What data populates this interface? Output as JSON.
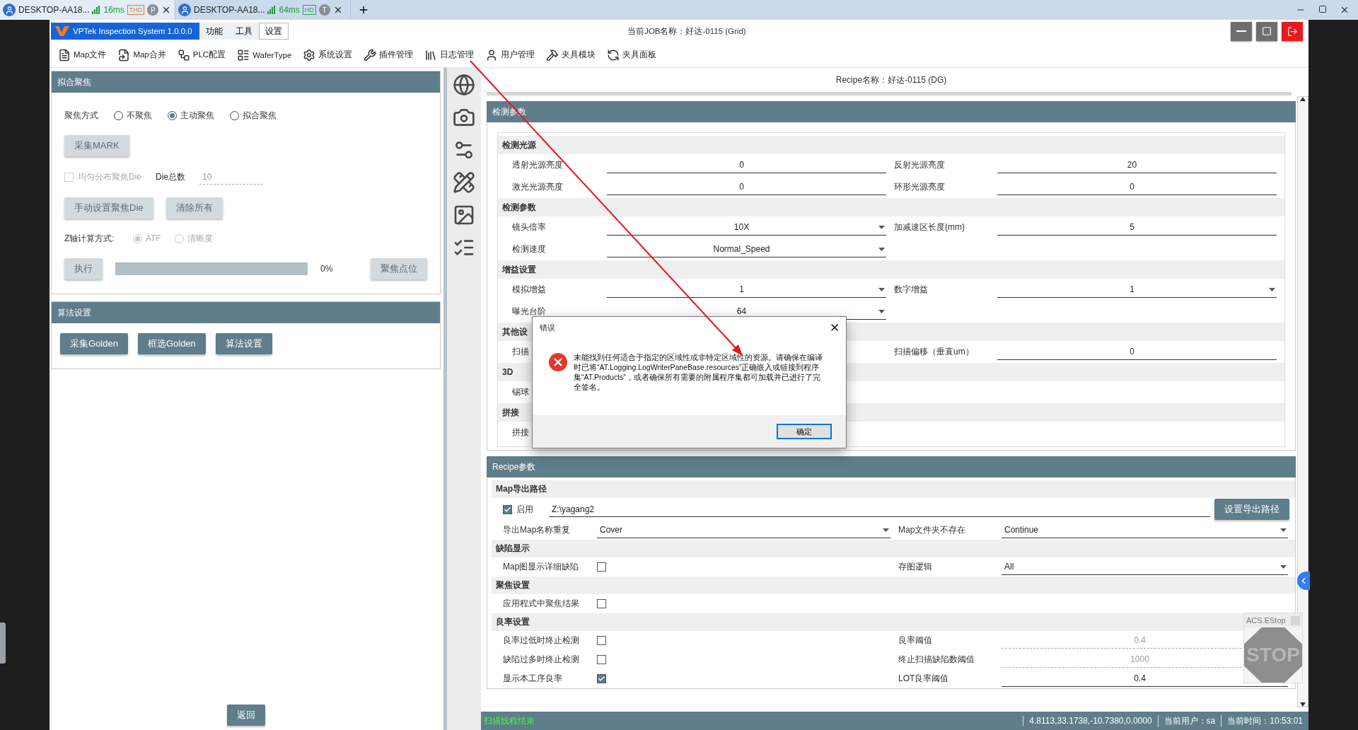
{
  "browser": {
    "tabs": [
      {
        "title": "DESKTOP-AA18...",
        "ping": "16ms",
        "quality": "THD",
        "color": "#d9822b",
        "account": "P",
        "selected": true
      },
      {
        "title": "DESKTOP-AA18...",
        "ping": "64ms",
        "quality": "HD",
        "color": "#2e9e4f",
        "account": "T",
        "selected": false
      }
    ]
  },
  "app": {
    "title": "VPTek Inspection System 1.0.0.0",
    "menu": [
      {
        "label": "功能",
        "selected": false
      },
      {
        "label": "工具",
        "selected": false
      },
      {
        "label": "设置",
        "selected": true
      }
    ],
    "job_title": "当前JOB名称：好达-0115 (Grid)"
  },
  "toolbar": [
    "Map文件",
    "Map合并",
    "PLC配置",
    "WaferType",
    "系统设置",
    "插件管理",
    "日志管理",
    "用户管理",
    "夹具模块",
    "夹具面板"
  ],
  "focus_panel": {
    "title": "拟合聚焦",
    "mode_label": "聚焦方式",
    "modes": [
      {
        "label": "不聚焦",
        "selected": false
      },
      {
        "label": "主动聚焦",
        "selected": true
      },
      {
        "label": "拟合聚焦",
        "selected": false
      }
    ],
    "mark_button": {
      "label": "采集MARK",
      "disabled": true
    },
    "even_checkbox": {
      "label": "均匀分布聚焦Die",
      "checked": false,
      "disabled": true
    },
    "die_count": {
      "label": "Die总数",
      "value": "10",
      "disabled": true
    },
    "buttons": [
      {
        "label": "手动设置聚焦Die",
        "disabled": true
      },
      {
        "label": "清除所有",
        "disabled": true
      }
    ],
    "z_label": "Z轴计算方式:",
    "z_modes": [
      {
        "label": "ATF",
        "selected": true,
        "disabled": true
      },
      {
        "label": "清晰度",
        "selected": false,
        "disabled": true
      }
    ],
    "run_button": {
      "label": "执行",
      "disabled": true
    },
    "progress": {
      "level": 0,
      "reading": "0%"
    },
    "point_button": {
      "label": "聚焦点位",
      "disabled": true
    }
  },
  "algo_panel": {
    "title": "算法设置",
    "buttons": [
      {
        "label": "采集Golden"
      },
      {
        "label": "框选Golden"
      },
      {
        "label": "算法设置"
      }
    ]
  },
  "back_button": "返回",
  "recipe_name": "Recipe名称：好达-0115 (DG)",
  "params": {
    "title": "检测参数",
    "sections": [
      {
        "title": "检测光源",
        "rows": [
          {
            "kind": "fields",
            "cells": [
              {
                "label": "透射光源亮度",
                "kind": "text",
                "value": "0"
              },
              {
                "label": "反射光源亮度",
                "kind": "text",
                "value": "20"
              }
            ]
          },
          {
            "kind": "fields",
            "cells": [
              {
                "label": "激光光源亮度",
                "kind": "text",
                "value": "0"
              },
              {
                "label": "环形光源亮度",
                "kind": "text",
                "value": "0"
              }
            ]
          }
        ]
      },
      {
        "title": "检测参数",
        "rows": [
          {
            "kind": "fields",
            "cells": [
              {
                "label": "镜头倍率",
                "kind": "dropdown",
                "value": "10X"
              },
              {
                "label": "加减速区长度(mm)",
                "kind": "text",
                "value": "5"
              }
            ]
          },
          {
            "kind": "fields",
            "cells": [
              {
                "label": "检测速度",
                "kind": "dropdown",
                "value": "Normal_Speed"
              }
            ]
          }
        ]
      },
      {
        "title": "增益设置",
        "rows": [
          {
            "kind": "fields",
            "cells": [
              {
                "label": "模拟增益",
                "kind": "dropdown",
                "value": "1"
              },
              {
                "label": "数字增益",
                "kind": "dropdown",
                "value": "1"
              }
            ]
          },
          {
            "kind": "fields",
            "cells": [
              {
                "label": "曝光台阶",
                "kind": "dropdown",
                "value": "64"
              }
            ]
          }
        ]
      },
      {
        "title": "其他设",
        "rows": [
          {
            "kind": "fields",
            "cells": [
              {
                "label": "扫描"
              },
              {
                "label": "扫描偏移（垂直um）",
                "kind": "text",
                "value": "0"
              }
            ]
          }
        ]
      },
      {
        "title": "3D",
        "rows": [
          {
            "kind": "fields",
            "cells": [
              {
                "label": "锡球"
              }
            ]
          }
        ]
      },
      {
        "title": "拼接",
        "rows": [
          {
            "kind": "fields",
            "cells": [
              {
                "label": "拼接"
              }
            ]
          }
        ]
      }
    ]
  },
  "recipe": {
    "title": "Recipe参数",
    "sections": [
      {
        "title": "Map导出路径",
        "rows": [
          {
            "kind": "path",
            "enable": {
              "label": "启用",
              "checked": true
            },
            "value": "Z:\\yagang2",
            "button": "设置导出路径"
          },
          {
            "kind": "fields",
            "cells": [
              {
                "label": "导出Map名称重复",
                "kind": "dropdown",
                "value": "Cover"
              },
              {
                "label": "Map文件夹不存在",
                "kind": "dropdown",
                "value": "Continue"
              }
            ]
          }
        ]
      },
      {
        "title": "缺陷显示",
        "rows": [
          {
            "kind": "fields",
            "cells": [
              {
                "label": "Map图显示详细缺陷",
                "kind": "checkbox",
                "checked": false
              },
              {
                "label": "存图逻辑",
                "kind": "dropdown",
                "value": "All"
              }
            ]
          }
        ]
      },
      {
        "title": "聚焦设置",
        "rows": [
          {
            "kind": "fields",
            "cells": [
              {
                "label": "应用程式中聚焦结果",
                "kind": "checkbox",
                "checked": false
              }
            ]
          }
        ]
      },
      {
        "title": "良率设置",
        "rows": [
          {
            "kind": "fields",
            "cells": [
              {
                "label": "良率过低时终止检测",
                "kind": "checkbox",
                "checked": false
              },
              {
                "label": "良率阈值",
                "kind": "text",
                "value": "0.4",
                "disabled": true
              }
            ]
          },
          {
            "kind": "fields",
            "cells": [
              {
                "label": "缺陷过多时终止检测",
                "kind": "checkbox",
                "checked": false
              },
              {
                "label": "终止扫描缺陷数阈值",
                "kind": "text",
                "value": "1000",
                "disabled": true
              }
            ]
          },
          {
            "kind": "fields",
            "cells": [
              {
                "label": "显示本工序良率",
                "kind": "checkbox",
                "checked": true
              },
              {
                "label": "LOT良率阈值",
                "kind": "text",
                "value": "0.4"
              }
            ]
          }
        ]
      }
    ]
  },
  "status": {
    "message": "扫描线程结束",
    "position": "4.8113,33.1738,-10.7380,0.0000",
    "user": "当前用户：sa",
    "time": "当前时间：10:53:01"
  },
  "dialog": {
    "title": "错误",
    "message": "未能找到任何适合于指定的区域性或非特定区域性的资源。请确保在编译时已将“AT.Logging.LogWriterPaneBase.resources”正确嵌入或链接到程序集“AT.Products”，或者确保所有需要的附属程序集都可加载并已进行了完全签名。",
    "button": "确定"
  },
  "estop": {
    "title": "ACS.EStop",
    "sign": "STOP"
  }
}
